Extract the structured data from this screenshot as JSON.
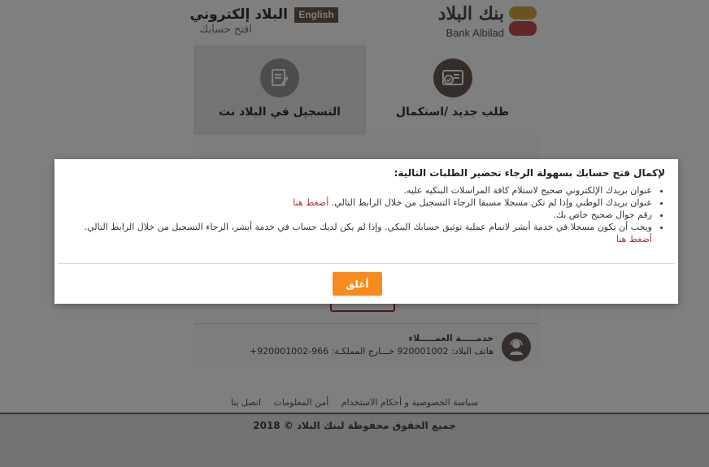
{
  "header": {
    "brand_ar": "بنك البلاد",
    "brand_en": "Bank Albilad",
    "title": "البلاد إلكتروني",
    "subtitle": "افتح حسابك",
    "lang_button": "English"
  },
  "tabs": [
    {
      "label": "طلب جديد /استكمال",
      "icon": "id-card-check-icon",
      "active": true
    },
    {
      "label": "التسجيل في البلاد نت",
      "icon": "edit-document-icon",
      "active": false
    }
  ],
  "support": {
    "title": "خدمـــــة العمـــــلاء",
    "phone": "هاتف البلاد: 920001002 خـــارج المملكـة: 966-920001002+"
  },
  "footer": {
    "links": [
      "سياسة الخصوصية و أحكام الاستخدام",
      "أمن المعلومات",
      "اتصل بنا"
    ],
    "copyright": "جميع الحقوق محفوظة لبنك البلاد © 2018"
  },
  "modal": {
    "heading": "لإكمال فتح حسابك بسهولة الرجاء تحضير الطلبات التالية:",
    "items": [
      {
        "text": "عنوان بريدك الإلكتروني صحيح لاستلام كافة المراسلات البنكيه عليه.",
        "link": ""
      },
      {
        "text": "عنوان بريدك الوطني وإذا لم تكن مسجلا مسبقا الرجاء التسجيل من خلال الرابط التالي.",
        "link": "أضغط هنا"
      },
      {
        "text": "رقم جوال صحيح خاص بك.",
        "link": ""
      },
      {
        "text": "ويجب أن تكون مسجلا في خدمة أبشر لاتمام عملية توثيق حسابك البنكي. وإذا لم يكن لديك حساب في خدمة أبشر، الرجاء التسجيل من خلال الرابط التالي.",
        "link": "أضغط هنا"
      }
    ],
    "close_label": "أغلق"
  },
  "colors": {
    "accent": "#f68b1f",
    "brand_brown": "#6b5b52",
    "link_red": "#b03030"
  }
}
